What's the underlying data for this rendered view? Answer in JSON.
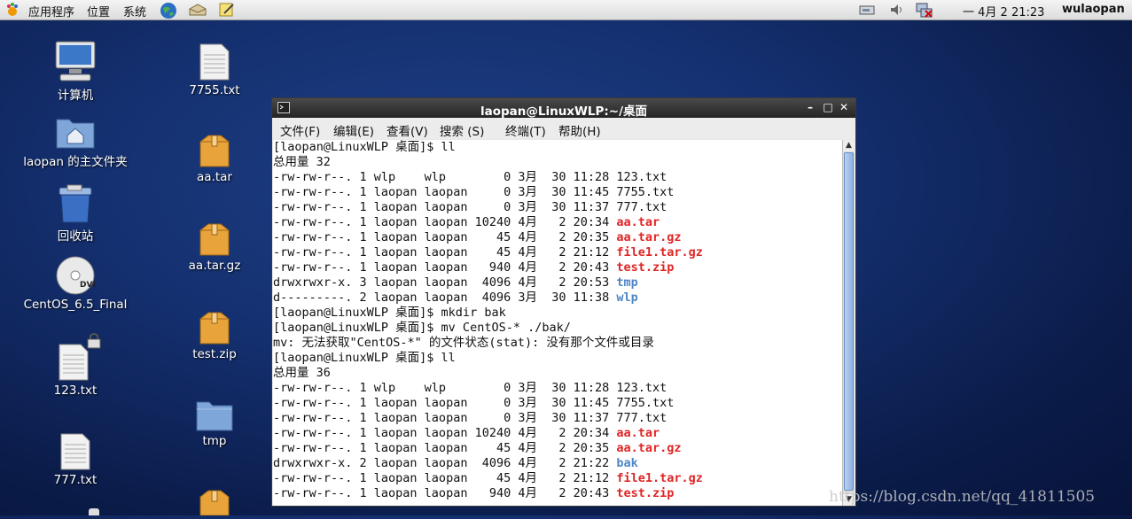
{
  "panel": {
    "menus": [
      "应用程序",
      "位置",
      "系统"
    ],
    "clock": "一 4月  2 21:23",
    "user": "wulaopan"
  },
  "desktop": {
    "icons": [
      {
        "label": "计算机",
        "icon": "computer-icon"
      },
      {
        "label": "laopan 的主文件夹",
        "icon": "home-folder-icon"
      },
      {
        "label": "回收站",
        "icon": "trash-icon"
      },
      {
        "label": "CentOS_6.5_Final",
        "icon": "dvd-icon"
      },
      {
        "label": "123.txt",
        "icon": "text-file-locked-icon"
      },
      {
        "label": "777.txt",
        "icon": "text-file-icon"
      },
      {
        "label": "7755.txt",
        "icon": "text-file-icon"
      },
      {
        "label": "aa.tar",
        "icon": "archive-icon"
      },
      {
        "label": "aa.tar.gz",
        "icon": "archive-icon"
      },
      {
        "label": "test.zip",
        "icon": "archive-icon"
      },
      {
        "label": "tmp",
        "icon": "folder-icon"
      }
    ]
  },
  "terminal": {
    "title": "laopan@LinuxWLP:~/桌面",
    "menu": [
      "文件(F)",
      "编辑(E)",
      "查看(V)",
      "搜索 (S)",
      "终端(T)",
      "帮助(H)"
    ],
    "lines": [
      {
        "text": "[laopan@LinuxWLP 桌面]$ ll",
        "hl": ""
      },
      {
        "text": "总用量 32",
        "hl": ""
      },
      {
        "text": "-rw-rw-r--. 1 wlp    wlp        0 3月  30 11:28 ",
        "hl": "",
        "name": "123.txt"
      },
      {
        "text": "-rw-rw-r--. 1 laopan laopan     0 3月  30 11:45 ",
        "hl": "",
        "name": "7755.txt"
      },
      {
        "text": "-rw-rw-r--. 1 laopan laopan     0 3月  30 11:37 ",
        "hl": "",
        "name": "777.txt"
      },
      {
        "text": "-rw-rw-r--. 1 laopan laopan 10240 4月   2 20:34 ",
        "hl": "red",
        "name": "aa.tar"
      },
      {
        "text": "-rw-rw-r--. 1 laopan laopan    45 4月   2 20:35 ",
        "hl": "red",
        "name": "aa.tar.gz"
      },
      {
        "text": "-rw-rw-r--. 1 laopan laopan    45 4月   2 21:12 ",
        "hl": "red",
        "name": "file1.tar.gz"
      },
      {
        "text": "-rw-rw-r--. 1 laopan laopan   940 4月   2 20:43 ",
        "hl": "red",
        "name": "test.zip"
      },
      {
        "text": "drwxrwxr-x. 3 laopan laopan  4096 4月   2 20:53 ",
        "hl": "blue",
        "name": "tmp"
      },
      {
        "text": "d---------. 2 laopan laopan  4096 3月  30 11:38 ",
        "hl": "blue",
        "name": "wlp"
      },
      {
        "text": "[laopan@LinuxWLP 桌面]$ mkdir bak",
        "hl": ""
      },
      {
        "text": "[laopan@LinuxWLP 桌面]$ mv CentOS-* ./bak/",
        "hl": ""
      },
      {
        "text": "mv: 无法获取\"CentOS-*\" 的文件状态(stat): 没有那个文件或目录",
        "hl": ""
      },
      {
        "text": "[laopan@LinuxWLP 桌面]$ ll",
        "hl": ""
      },
      {
        "text": "总用量 36",
        "hl": ""
      },
      {
        "text": "-rw-rw-r--. 1 wlp    wlp        0 3月  30 11:28 ",
        "hl": "",
        "name": "123.txt"
      },
      {
        "text": "-rw-rw-r--. 1 laopan laopan     0 3月  30 11:45 ",
        "hl": "",
        "name": "7755.txt"
      },
      {
        "text": "-rw-rw-r--. 1 laopan laopan     0 3月  30 11:37 ",
        "hl": "",
        "name": "777.txt"
      },
      {
        "text": "-rw-rw-r--. 1 laopan laopan 10240 4月   2 20:34 ",
        "hl": "red",
        "name": "aa.tar"
      },
      {
        "text": "-rw-rw-r--. 1 laopan laopan    45 4月   2 20:35 ",
        "hl": "red",
        "name": "aa.tar.gz"
      },
      {
        "text": "drwxrwxr-x. 2 laopan laopan  4096 4月   2 21:22 ",
        "hl": "blue",
        "name": "bak"
      },
      {
        "text": "-rw-rw-r--. 1 laopan laopan    45 4月   2 21:12 ",
        "hl": "red",
        "name": "file1.tar.gz"
      },
      {
        "text": "-rw-rw-r--. 1 laopan laopan   940 4月   2 20:43 ",
        "hl": "red",
        "name": "test.zip"
      }
    ]
  },
  "watermark": "https://blog.csdn.net/qq_41811505",
  "colors": {
    "archive": "#e02424",
    "directory": "#4f86c8"
  }
}
